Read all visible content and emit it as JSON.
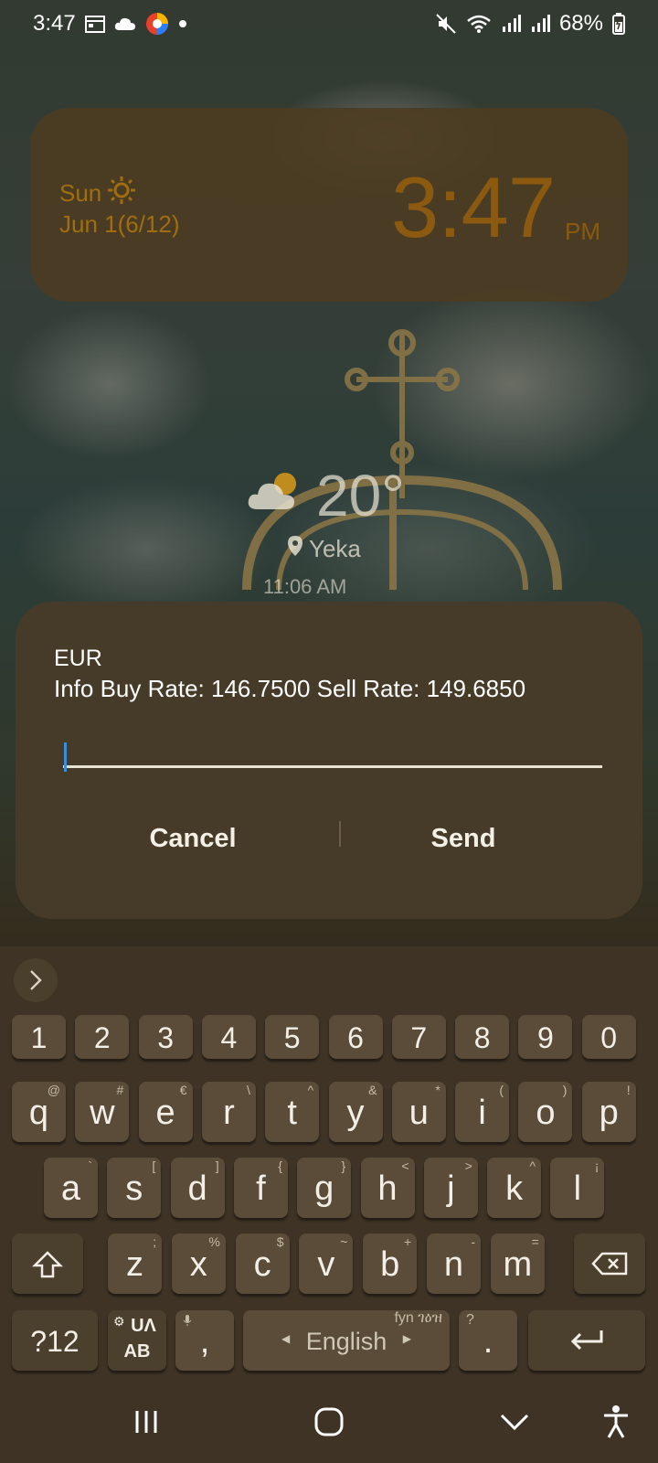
{
  "status_bar": {
    "time": "3:47",
    "battery": "68%"
  },
  "clock_widget": {
    "day": "Sun",
    "date": "Jun 1(6/12)",
    "time": "3:47",
    "ampm": "PM"
  },
  "weather": {
    "temperature": "20°",
    "location": "Yeka",
    "updated": "11:06 AM"
  },
  "dialog": {
    "title": "EUR",
    "message": "Info Buy Rate: 146.7500 Sell Rate: 149.6850",
    "input_value": "",
    "cancel_label": "Cancel",
    "send_label": "Send"
  },
  "keyboard": {
    "number_row": [
      "1",
      "2",
      "3",
      "4",
      "5",
      "6",
      "7",
      "8",
      "9",
      "0"
    ],
    "row1": [
      {
        "key": "q",
        "sub": "@"
      },
      {
        "key": "w",
        "sub": "#"
      },
      {
        "key": "e",
        "sub": "€"
      },
      {
        "key": "r",
        "sub": "\\"
      },
      {
        "key": "t",
        "sub": "^"
      },
      {
        "key": "y",
        "sub": "&"
      },
      {
        "key": "u",
        "sub": "*"
      },
      {
        "key": "i",
        "sub": "("
      },
      {
        "key": "o",
        "sub": ")"
      },
      {
        "key": "p",
        "sub": "!"
      }
    ],
    "row2": [
      {
        "key": "a",
        "sub": "`"
      },
      {
        "key": "s",
        "sub": "["
      },
      {
        "key": "d",
        "sub": "]"
      },
      {
        "key": "f",
        "sub": "{"
      },
      {
        "key": "g",
        "sub": "}"
      },
      {
        "key": "h",
        "sub": "<"
      },
      {
        "key": "j",
        "sub": ">"
      },
      {
        "key": "k",
        "sub": "^"
      },
      {
        "key": "l",
        "sub": "¡"
      }
    ],
    "row3": [
      {
        "key": "z",
        "sub": ";"
      },
      {
        "key": "x",
        "sub": "%"
      },
      {
        "key": "c",
        "sub": "$"
      },
      {
        "key": "v",
        "sub": "~"
      },
      {
        "key": "b",
        "sub": "+"
      },
      {
        "key": "n",
        "sub": "-"
      },
      {
        "key": "m",
        "sub": "="
      }
    ],
    "symbols_label": "?12",
    "lang_switch_top": "UΛ",
    "lang_switch_bottom": "AB",
    "comma": ",",
    "space_label": "English",
    "space_hint": "fyn ገዕዝ",
    "period": ".",
    "period_sub": "?"
  },
  "colors": {
    "dialog_bg": "#463b28",
    "key_bg": "#5a4c38",
    "keyboard_bg": "#3e3325",
    "clock_accent": "#a06d10",
    "cursor": "#3b8de0"
  }
}
